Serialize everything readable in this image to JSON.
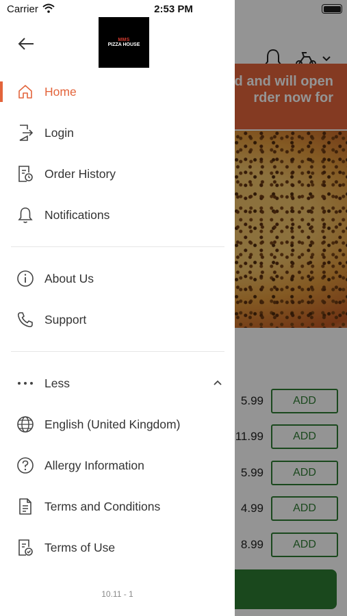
{
  "status_bar": {
    "carrier": "Carrier",
    "time": "2:53 PM"
  },
  "drawer": {
    "logo": {
      "line1": "MMS",
      "line2": "PIZZA HOUSE"
    },
    "menu_primary": [
      {
        "label": "Home",
        "icon": "home-icon",
        "active": true
      },
      {
        "label": "Login",
        "icon": "login-icon"
      },
      {
        "label": "Order History",
        "icon": "order-history-icon"
      },
      {
        "label": "Notifications",
        "icon": "bell-icon"
      }
    ],
    "menu_secondary": [
      {
        "label": "About Us",
        "icon": "info-icon"
      },
      {
        "label": "Support",
        "icon": "phone-icon"
      }
    ],
    "less": {
      "label": "Less",
      "icon": "more-dots-icon"
    },
    "menu_more": [
      {
        "label": "English (United Kingdom)",
        "icon": "globe-icon"
      },
      {
        "label": "Allergy Information",
        "icon": "question-icon"
      },
      {
        "label": "Terms and Conditions",
        "icon": "document-icon"
      },
      {
        "label": "Terms of Use",
        "icon": "document-check-icon"
      }
    ],
    "version": "10.11 - 1",
    "accent_color": "#e3643b"
  },
  "background": {
    "banner_lines": [
      "d and will open",
      "rder now for"
    ],
    "items": [
      {
        "price": "5.99",
        "add_label": "ADD"
      },
      {
        "price": "11.99",
        "add_label": "ADD"
      },
      {
        "price": "5.99",
        "add_label": "ADD"
      },
      {
        "price": "4.99",
        "add_label": "ADD"
      },
      {
        "price": "8.99",
        "add_label": "ADD"
      }
    ],
    "add_color": "#2e7d32"
  }
}
